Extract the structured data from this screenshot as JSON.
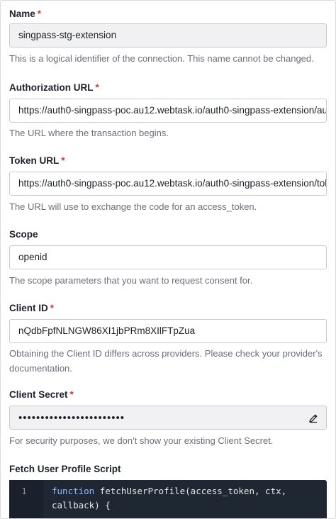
{
  "form": {
    "name": {
      "label": "Name",
      "required_mark": "*",
      "value": "singpass-stg-extension",
      "help": "This is a logical identifier of the connection. This name cannot be changed."
    },
    "authorization_url": {
      "label": "Authorization URL",
      "required_mark": "*",
      "value": "https://auth0-singpass-poc.au12.webtask.io/auth0-singpass-extension/au",
      "help": "The URL where the transaction begins."
    },
    "token_url": {
      "label": "Token URL",
      "required_mark": "*",
      "value": "https://auth0-singpass-poc.au12.webtask.io/auth0-singpass-extension/tok",
      "help": "The URL will use to exchange the code for an access_token."
    },
    "scope": {
      "label": "Scope",
      "value": "openid",
      "help": "The scope parameters that you want to request consent for."
    },
    "client_id": {
      "label": "Client ID",
      "required_mark": "*",
      "value": "nQdbFpfNLNGW86XI1jbPRm8XIlFTpZua",
      "help": "Obtaining the Client ID differs across providers. Please check your provider's documentation."
    },
    "client_secret": {
      "label": "Client Secret",
      "required_mark": "*",
      "masked_value": "••••••••••••••••••••••••",
      "edit_icon": "pencil-icon",
      "help": "For security purposes, we don't show your existing Client Secret."
    },
    "fetch_script": {
      "label": "Fetch User Profile Script",
      "line_number": "1",
      "keyword": "function",
      "line1_rest": " fetchUserProfile(access_token, ctx,",
      "line2": "callback) {"
    }
  },
  "colors": {
    "required": "#d03c38",
    "help_text": "#6a6e7a",
    "code_bg": "#1f2733",
    "keyword": "#8fb4ff"
  }
}
